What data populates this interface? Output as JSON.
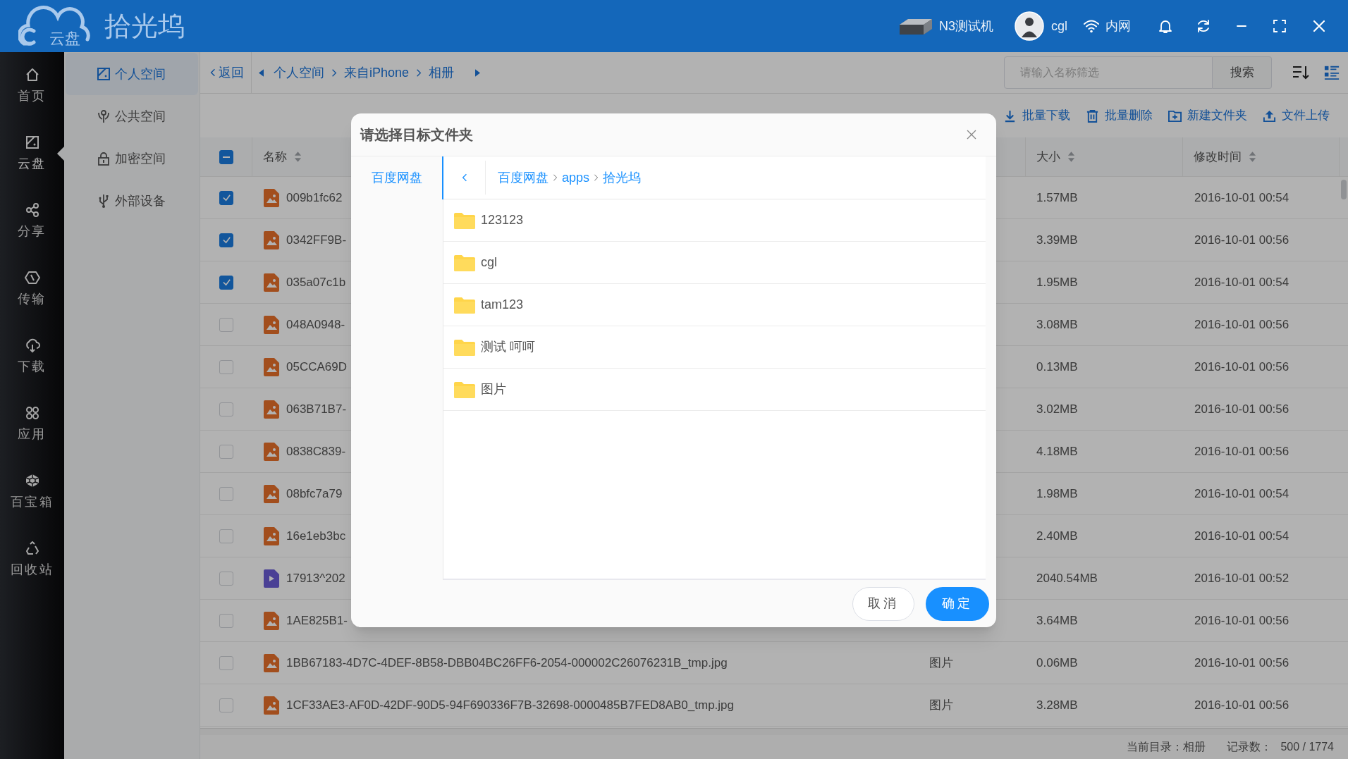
{
  "app": {
    "logo_badge": "云盘",
    "logo_title": "拾光坞"
  },
  "header": {
    "device": "N3测试机",
    "user": "cgl",
    "network": "内网"
  },
  "sidebar": {
    "items": [
      {
        "label": "首页",
        "selected": false
      },
      {
        "label": "云盘",
        "selected": true
      },
      {
        "label": "分享",
        "selected": false
      },
      {
        "label": "传输",
        "selected": false
      },
      {
        "label": "下载",
        "selected": false
      },
      {
        "label": "应用",
        "selected": false
      },
      {
        "label": "百宝箱",
        "selected": false
      },
      {
        "label": "回收站",
        "selected": false
      }
    ]
  },
  "nav": {
    "items": [
      {
        "label": "个人空间",
        "selected": true
      },
      {
        "label": "公共空间",
        "selected": false
      },
      {
        "label": "加密空间",
        "selected": false
      },
      {
        "label": "外部设备",
        "selected": false
      }
    ]
  },
  "breadcrumb": {
    "back": "返回",
    "path": [
      "个人空间",
      "来自iPhone",
      "相册"
    ]
  },
  "filter": {
    "placeholder": "请输入名称筛选",
    "button": "搜索"
  },
  "toolbar": [
    "批量下载",
    "批量删除",
    "新建文件夹",
    "文件上传"
  ],
  "table": {
    "indeterminate": true,
    "columns": {
      "name": "名称",
      "size": "大小",
      "modified": "修改时间"
    },
    "rows": [
      {
        "checked": true,
        "kind": "image",
        "name": "009b1fc62",
        "size": "1.57MB",
        "modified": "2016-10-01 00:54"
      },
      {
        "checked": true,
        "kind": "image",
        "name": "0342FF9B-",
        "size": "3.39MB",
        "modified": "2016-10-01 00:56"
      },
      {
        "checked": true,
        "kind": "image",
        "name": "035a07c1b",
        "size": "1.95MB",
        "modified": "2016-10-01 00:54"
      },
      {
        "checked": false,
        "kind": "image",
        "name": "048A0948-",
        "size": "3.08MB",
        "modified": "2016-10-01 00:56"
      },
      {
        "checked": false,
        "kind": "image",
        "name": "05CCA69D",
        "size": "0.13MB",
        "modified": "2016-10-01 00:56"
      },
      {
        "checked": false,
        "kind": "image",
        "name": "063B71B7-",
        "size": "3.02MB",
        "modified": "2016-10-01 00:56"
      },
      {
        "checked": false,
        "kind": "image",
        "name": "0838C839-",
        "size": "4.18MB",
        "modified": "2016-10-01 00:56"
      },
      {
        "checked": false,
        "kind": "image",
        "name": "08bfc7a79",
        "size": "1.98MB",
        "modified": "2016-10-01 00:54"
      },
      {
        "checked": false,
        "kind": "image",
        "name": "16e1eb3bc",
        "size": "2.40MB",
        "modified": "2016-10-01 00:54"
      },
      {
        "checked": false,
        "kind": "video",
        "name": "17913^202",
        "size": "2040.54MB",
        "modified": "2016-10-01 00:52"
      },
      {
        "checked": false,
        "kind": "image",
        "name": "1AE825B1-",
        "size": "3.64MB",
        "modified": "2016-10-01 00:56"
      },
      {
        "checked": false,
        "kind": "image",
        "name": "1BB67183-4D7C-4DEF-8B58-DBB04BC26FF6-2054-000002C26076231B_tmp.jpg",
        "type": "图片",
        "size": "0.06MB",
        "modified": "2016-10-01 00:56"
      },
      {
        "checked": false,
        "kind": "image",
        "name": "1CF33AE3-AF0D-42DF-90D5-94F690336F7B-32698-0000485B7FED8AB0_tmp.jpg",
        "type": "图片",
        "size": "3.28MB",
        "modified": "2016-10-01 00:56"
      }
    ]
  },
  "status_bar": {
    "directory": "当前目录：相册",
    "count_label": "记录数：",
    "count": "500 / 1774"
  },
  "dialog": {
    "title": "请选择目标文件夹",
    "sources": [
      {
        "label": "百度网盘",
        "selected": true
      }
    ],
    "path": [
      "百度网盘",
      "apps",
      "拾光坞"
    ],
    "folders": [
      "123123",
      "cgl",
      "tam123",
      "测试 呵呵",
      "图片"
    ],
    "cancel": "取消",
    "ok": "确定"
  }
}
